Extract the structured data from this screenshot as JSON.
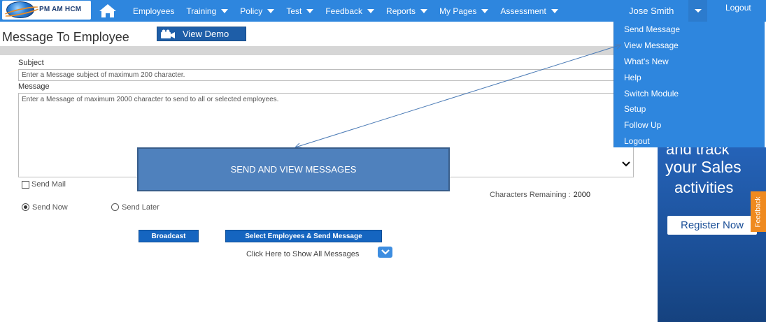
{
  "nav": {
    "brand": "PM AM HCM",
    "items": [
      {
        "label": "Employees",
        "caret": false
      },
      {
        "label": "Training",
        "caret": true
      },
      {
        "label": "Policy",
        "caret": true
      },
      {
        "label": "Test",
        "caret": true
      },
      {
        "label": "Feedback",
        "caret": true
      },
      {
        "label": "Reports",
        "caret": true
      },
      {
        "label": "My Pages",
        "caret": true
      },
      {
        "label": "Assessment",
        "caret": true
      }
    ],
    "user": "Jose Smith",
    "logout": "Logout"
  },
  "header": {
    "title": "Message To Employee",
    "demo_button": "View Demo"
  },
  "form": {
    "subject_label": "Subject",
    "subject_placeholder": "Enter a Message subject of maximum 200 character.",
    "message_label": "Message",
    "message_placeholder": "Enter a Message of maximum 2000 character to send to all or selected employees.",
    "send_mail_label": "Send Mail",
    "send_now_label": "Send Now",
    "send_later_label": "Send Later",
    "chars_label": "Characters Remaining :",
    "chars_value": "2000",
    "broadcast_button": "Broadcast",
    "select_send_button": "Select Employees & Send Message",
    "show_all_text": "Click Here to Show All Messages"
  },
  "dropdown": {
    "items": [
      "Send Message",
      "View Message",
      "What's New",
      "Help",
      "Switch Module",
      "Setup",
      "Follow Up",
      "Logout"
    ]
  },
  "ad": {
    "line1": "and track",
    "line2": "your Sales",
    "line3": "activities",
    "button": "Register Now",
    "feedback_tab": "Feedback"
  },
  "callout": {
    "text": "SEND AND VIEW MESSAGES"
  },
  "colors": {
    "nav_bg": "#2e86de",
    "callout_bg": "#4f81bd",
    "button_bg": "#1565c0",
    "feedback_tab": "#ef8a1f"
  }
}
